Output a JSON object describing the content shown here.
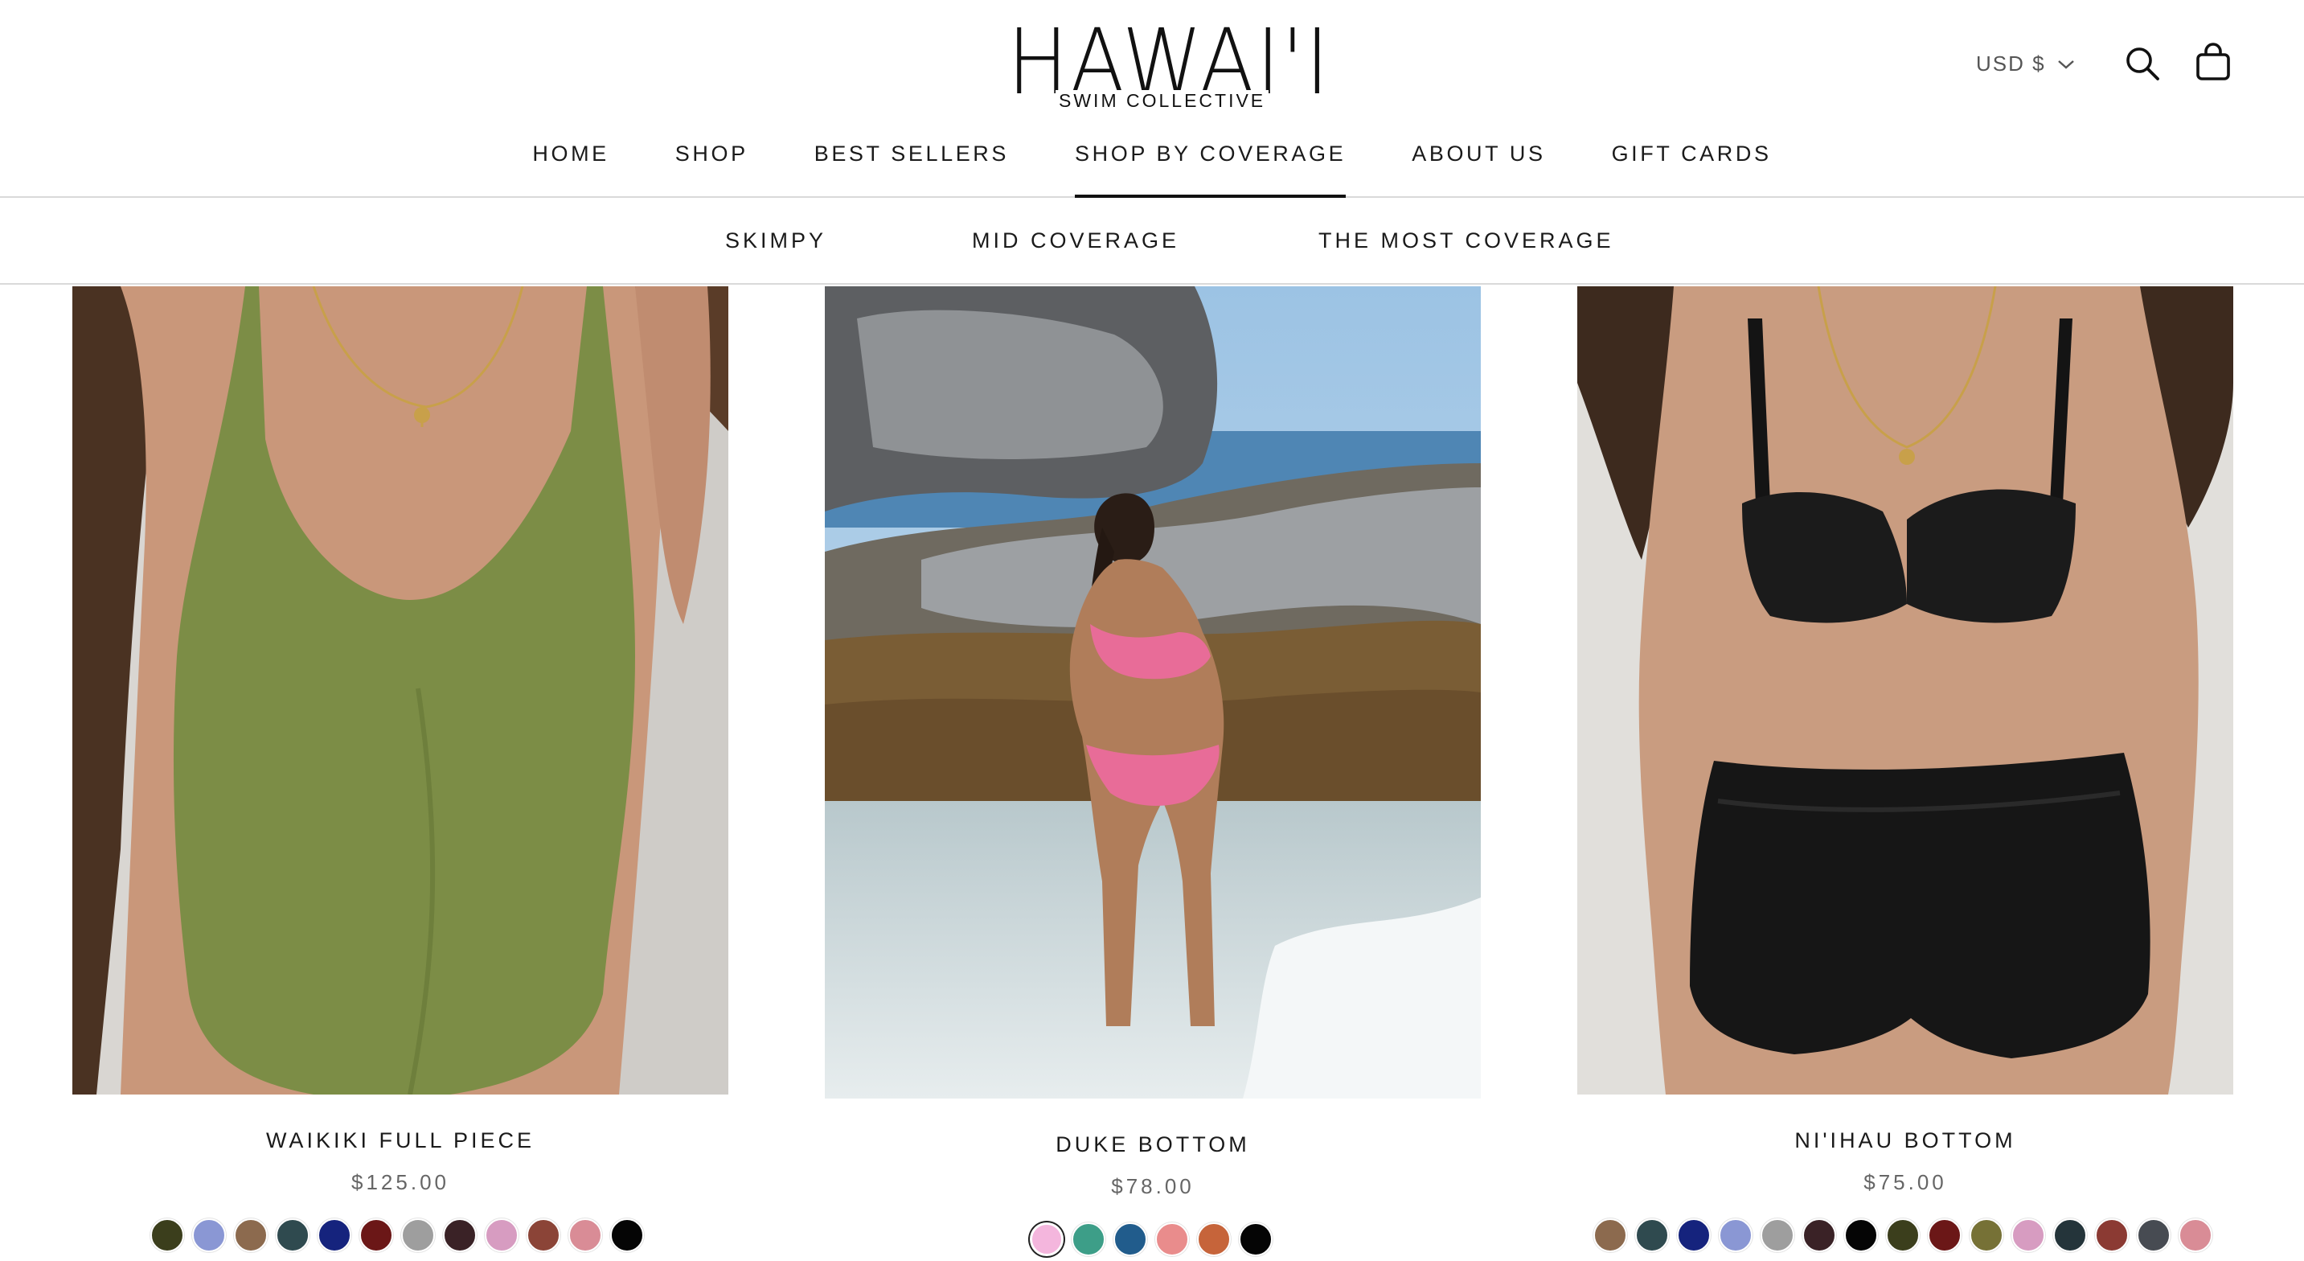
{
  "brand": {
    "logo_main": "HAWAI'I",
    "logo_sub": "SWIM COLLECTIVE"
  },
  "header": {
    "currency": "USD $",
    "search_icon": "search-icon",
    "cart_icon": "shopping-bag-icon"
  },
  "main_nav": [
    {
      "label": "HOME"
    },
    {
      "label": "SHOP"
    },
    {
      "label": "BEST SELLERS"
    },
    {
      "label": "SHOP BY COVERAGE",
      "active": true
    },
    {
      "label": "ABOUT US"
    },
    {
      "label": "GIFT CARDS"
    }
  ],
  "sub_nav": [
    {
      "label": "SKIMPY"
    },
    {
      "label": "MID COVERAGE"
    },
    {
      "label": "THE MOST COVERAGE"
    }
  ],
  "products": [
    {
      "title": "WAIKIKI FULL PIECE",
      "price": "$125.00",
      "swatches": [
        "#3b3e1c",
        "#8a97d4",
        "#8c6a4e",
        "#2f4a4f",
        "#15237d",
        "#6b1717",
        "#9e9e9e",
        "#3a2226",
        "#d79cc1",
        "#8b4437",
        "#d98c96",
        "#050505"
      ]
    },
    {
      "title": "DUKE BOTTOM",
      "price": "$78.00",
      "swatches": [
        "#f4b6dd",
        "#3d9e88",
        "#215c8c",
        "#e98c8c",
        "#c6643a",
        "#050505"
      ]
    },
    {
      "title": "NI'IHAU BOTTOM",
      "price": "$75.00",
      "swatches": [
        "#8c6a4e",
        "#2f4a4f",
        "#15237d",
        "#8a97d4",
        "#9e9e9e",
        "#3a2226",
        "#050505",
        "#3b3e1c",
        "#6b1717",
        "#767136",
        "#d79cc1",
        "#24343a",
        "#8b3a33",
        "#474b52",
        "#d98c96"
      ]
    }
  ]
}
